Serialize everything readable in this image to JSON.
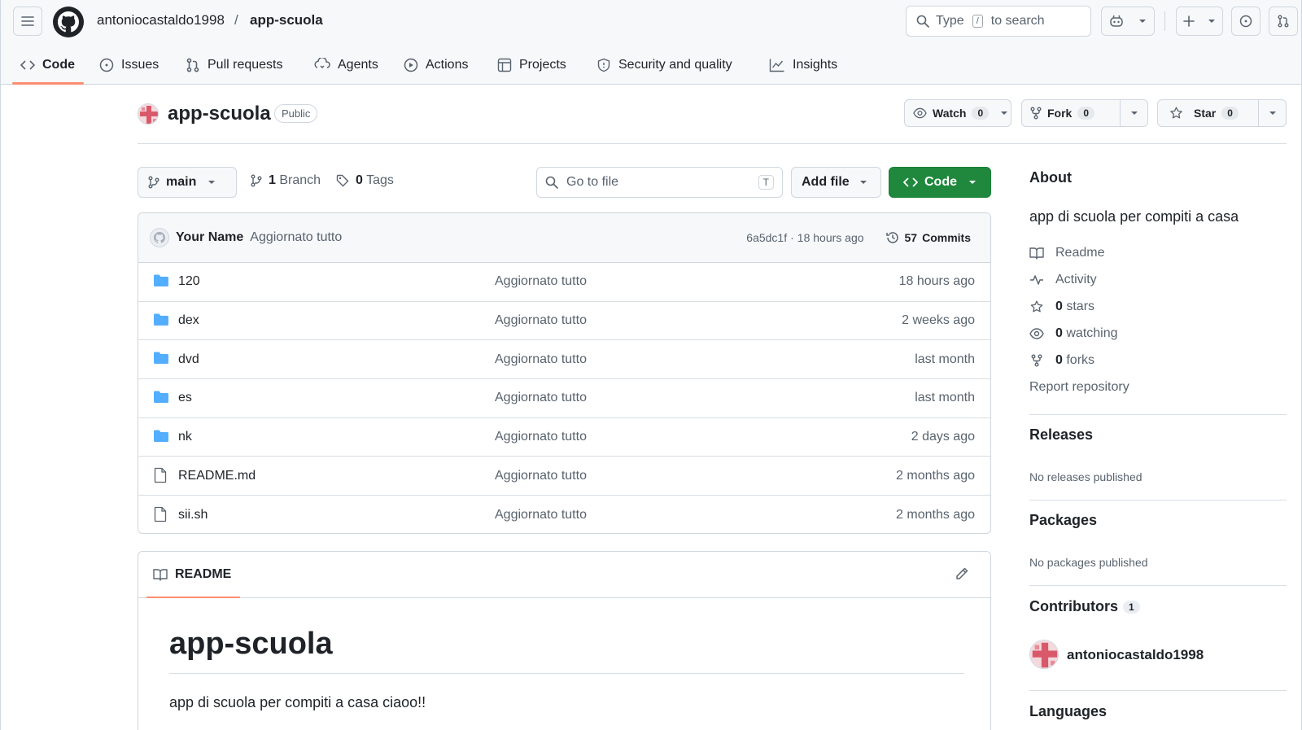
{
  "header": {
    "owner": "antoniocastaldo1998",
    "separator": "/",
    "repo": "app-scuola",
    "search": {
      "prefix": "Type",
      "key": "/",
      "suffix": "to search"
    }
  },
  "tabs": [
    {
      "label": "Code",
      "icon": "code-icon",
      "active": true
    },
    {
      "label": "Issues",
      "icon": "issue-icon"
    },
    {
      "label": "Pull requests",
      "icon": "pull-request-icon"
    },
    {
      "label": "Agents",
      "icon": "agents-icon"
    },
    {
      "label": "Actions",
      "icon": "play-icon"
    },
    {
      "label": "Projects",
      "icon": "table-icon"
    },
    {
      "label": "Security and quality",
      "icon": "shield-icon"
    },
    {
      "label": "Insights",
      "icon": "graph-icon"
    }
  ],
  "repo_header": {
    "name": "app-scuola",
    "visibility": "Public",
    "watch": {
      "label": "Watch",
      "count": "0"
    },
    "fork": {
      "label": "Fork",
      "count": "0"
    },
    "star": {
      "label": "Star",
      "count": "0"
    }
  },
  "file_nav": {
    "branch": "main",
    "branches_count": "1",
    "branches_label": "Branch",
    "tags_count": "0",
    "tags_label": "Tags",
    "goto_placeholder": "Go to file",
    "goto_key": "T",
    "add_file": "Add file",
    "code": "Code"
  },
  "latest_commit": {
    "author": "Your Name",
    "message": "Aggiornato tutto",
    "sha": "6a5dc1f",
    "dot": "·",
    "time": "18 hours ago",
    "commits_count": "57",
    "commits_label": "Commits"
  },
  "files": [
    {
      "name": "120",
      "type": "folder",
      "message": "Aggiornato tutto",
      "time": "18 hours ago"
    },
    {
      "name": "dex",
      "type": "folder",
      "message": "Aggiornato tutto",
      "time": "2 weeks ago"
    },
    {
      "name": "dvd",
      "type": "folder",
      "message": "Aggiornato tutto",
      "time": "last month"
    },
    {
      "name": "es",
      "type": "folder",
      "message": "Aggiornato tutto",
      "time": "last month"
    },
    {
      "name": "nk",
      "type": "folder",
      "message": "Aggiornato tutto",
      "time": "2 days ago"
    },
    {
      "name": "README.md",
      "type": "file",
      "message": "Aggiornato tutto",
      "time": "2 months ago"
    },
    {
      "name": "sii.sh",
      "type": "file",
      "message": "Aggiornato tutto",
      "time": "2 months ago"
    }
  ],
  "readme": {
    "tab_label": "README",
    "heading": "app-scuola",
    "body": "app di scuola per compiti a casa ciaoo!!"
  },
  "sidebar": {
    "about_title": "About",
    "description": "app di scuola per compiti a casa",
    "readme": "Readme",
    "activity": "Activity",
    "stars_count": "0",
    "stars_label": "stars",
    "watching_count": "0",
    "watching_label": "watching",
    "forks_count": "0",
    "forks_label": "forks",
    "report": "Report repository",
    "releases_title": "Releases",
    "releases_none": "No releases published",
    "packages_title": "Packages",
    "packages_none": "No packages published",
    "contributors_title": "Contributors",
    "contributors_count": "1",
    "contributor_name": "antoniocastaldo1998",
    "languages_title": "Languages"
  },
  "colors": {
    "accent_green": "#1f883d",
    "tab_underline": "#fd8c73",
    "folder_blue": "#54aeff"
  }
}
